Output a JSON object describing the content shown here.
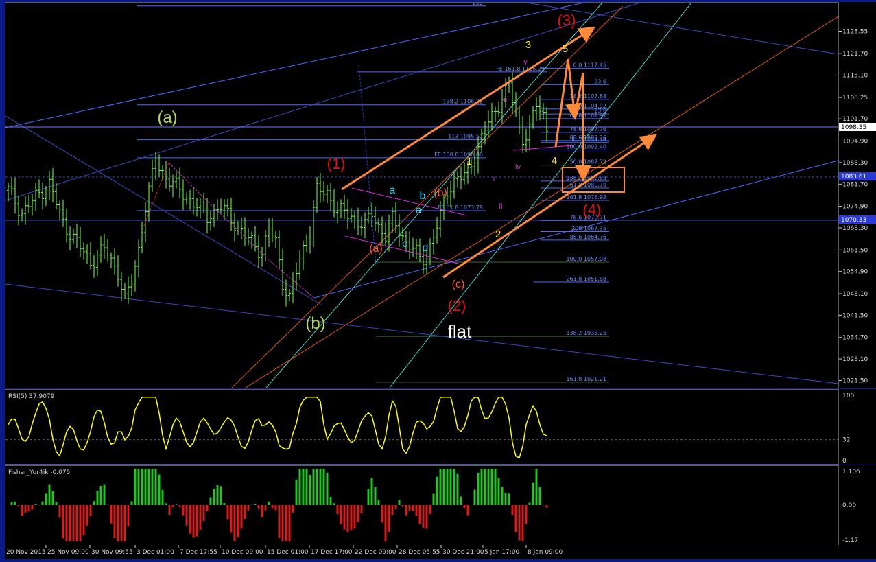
{
  "chart_data": [
    {
      "type": "candlestick",
      "panel": "price",
      "y_axis_ticks": [
        1128.55,
        1121.7,
        1115.1,
        1108.25,
        1101.7,
        1094.9,
        1088.3,
        1081.7,
        1074.9,
        1068.3,
        1061.5,
        1054.9,
        1048.1,
        1041.5,
        1034.7,
        1028.1,
        1021.5
      ],
      "ylim": [
        1019.5,
        1137.5
      ],
      "current_price_labels": [
        "1098.35",
        "1083.61",
        "1070.33"
      ],
      "x_tick_labels": [
        "20 Nov 2015",
        "25 Nov 09:00",
        "30 Nov 09:55",
        "3 Dec 01:00",
        "7 Dec 17:55",
        "10 Dec 09:00",
        "15 Dec 01:00",
        "17 Dec 17:00",
        "22 Dec 09:00",
        "28 Dec 05:55",
        "30 Dec 21:00",
        "5 Jan 17:00",
        "8 Jan 09:00"
      ],
      "close_path": [
        [
          0,
          1080
        ],
        [
          4,
          1073
        ],
        [
          8,
          1078
        ],
        [
          12,
          1082
        ],
        [
          16,
          1070
        ],
        [
          20,
          1064
        ],
        [
          24,
          1058
        ],
        [
          28,
          1062
        ],
        [
          32,
          1055
        ],
        [
          34,
          1046
        ],
        [
          36,
          1052
        ],
        [
          38,
          1062
        ],
        [
          40,
          1075
        ],
        [
          43,
          1089
        ],
        [
          46,
          1084
        ],
        [
          50,
          1080
        ],
        [
          54,
          1076
        ],
        [
          58,
          1072
        ],
        [
          62,
          1075
        ],
        [
          66,
          1070
        ],
        [
          70,
          1065
        ],
        [
          74,
          1061
        ],
        [
          76,
          1068
        ],
        [
          78,
          1064
        ],
        [
          80,
          1052
        ],
        [
          82,
          1047
        ],
        [
          84,
          1055
        ],
        [
          86,
          1062
        ],
        [
          88,
          1068
        ],
        [
          90,
          1080
        ],
        [
          93,
          1079
        ],
        [
          96,
          1074
        ],
        [
          100,
          1072
        ],
        [
          104,
          1069
        ],
        [
          106,
          1073
        ],
        [
          108,
          1069
        ],
        [
          110,
          1066
        ],
        [
          112,
          1071
        ],
        [
          114,
          1068
        ],
        [
          116,
          1064
        ],
        [
          118,
          1062
        ],
        [
          120,
          1059
        ],
        [
          122,
          1060
        ],
        [
          124,
          1066
        ],
        [
          126,
          1072
        ],
        [
          128,
          1080
        ],
        [
          130,
          1083
        ],
        [
          134,
          1085
        ],
        [
          136,
          1091
        ],
        [
          138,
          1096
        ],
        [
          140,
          1101
        ],
        [
          142,
          1104
        ],
        [
          144,
          1109
        ],
        [
          146,
          1112
        ],
        [
          148,
          1103
        ],
        [
          150,
          1096
        ],
        [
          152,
          1099
        ],
        [
          154,
          1106
        ],
        [
          156,
          1103
        ],
        [
          157,
          1099
        ]
      ],
      "fib_levels": [
        {
          "label": "200",
          "price": 1136.5
        },
        {
          "label": "FE 161.8 1116.29",
          "price": 1116.29
        },
        {
          "label": "0.0 1117.45",
          "price": 1117.45
        },
        {
          "label": "23.6",
          "price": 1112.4
        },
        {
          "label": "138.2 1106.22",
          "price": 1106.22
        },
        {
          "label": "38.2 1107.88",
          "price": 1107.88
        },
        {
          "label": "50.0 1104.92",
          "price": 1104.92
        },
        {
          "label": "61.8 1101.97",
          "price": 1101.97
        },
        {
          "label": "23.6",
          "price": 1103.4
        },
        {
          "label": "78.6 1097.76",
          "price": 1097.76
        },
        {
          "label": "113 1095.52",
          "price": 1095.52
        },
        {
          "label": "88.6 1095.26",
          "price": 1095.26
        },
        {
          "label": "38.2 1094.74",
          "price": 1094.74
        },
        {
          "label": "100.0 1092.40",
          "price": 1092.4
        },
        {
          "label": "FE 100.0 1090.00",
          "price": 1090.0
        },
        {
          "label": "50.0 1087.72",
          "price": 1087.72
        },
        {
          "label": "138.2 1082.83",
          "price": 1082.83
        },
        {
          "label": "61.8 1080.70",
          "price": 1080.7
        },
        {
          "label": "FE 61.8 1073.78",
          "price": 1073.78
        },
        {
          "label": "161.8 1076.92",
          "price": 1076.92
        },
        {
          "label": "78.6 1070.71",
          "price": 1070.71
        },
        {
          "label": "200 1067.35",
          "price": 1067.35
        },
        {
          "label": "88.6 1064.76",
          "price": 1064.76
        },
        {
          "label": "100.0 1057.98",
          "price": 1057.98
        },
        {
          "label": "261.8 1051.88",
          "price": 1051.88
        },
        {
          "label": "138.2 1035.25",
          "price": 1035.25
        },
        {
          "label": "161.8 1021.21",
          "price": 1021.21
        }
      ],
      "wave_labels": [
        {
          "text": "(a)",
          "color": "#b5d84a"
        },
        {
          "text": "(b)",
          "color": "#b5d84a"
        },
        {
          "text": "(1)",
          "color": "#e01010"
        },
        {
          "text": "(2)",
          "color": "#e01010"
        },
        {
          "text": "(3)",
          "color": "#e01010"
        },
        {
          "text": "(4)",
          "color": "#e01010"
        },
        {
          "text": "flat",
          "color": "#ffffff"
        },
        {
          "text": "(a)",
          "color": "#ff5a2a"
        },
        {
          "text": "(b)",
          "color": "#ff5a2a"
        },
        {
          "text": "(c)",
          "color": "#ff5a2a"
        },
        {
          "text": "a",
          "color": "#2ad8ff"
        },
        {
          "text": "b",
          "color": "#2ad8ff"
        },
        {
          "text": "c",
          "color": "#2ad8ff"
        },
        {
          "text": "d",
          "color": "#2ad8ff"
        },
        {
          "text": "e",
          "color": "#2ad8ff"
        },
        {
          "text": "1",
          "color": "#ffe81a"
        },
        {
          "text": "2",
          "color": "#ffe81a"
        },
        {
          "text": "3",
          "color": "#ffe81a"
        },
        {
          "text": "4",
          "color": "#ffe81a"
        },
        {
          "text": "5",
          "color": "#ffe81a"
        },
        {
          "text": "i",
          "color": "#cc33cc"
        },
        {
          "text": "ii",
          "color": "#cc33cc"
        },
        {
          "text": "iii",
          "color": "#cc33cc"
        },
        {
          "text": "iv",
          "color": "#cc33cc"
        },
        {
          "text": "v",
          "color": "#cc33cc"
        }
      ]
    },
    {
      "type": "line",
      "panel": "RSI",
      "title": "RSI(5) 37.9079",
      "ylim": [
        0,
        100
      ],
      "y_ticks": [
        "100",
        "32",
        "0"
      ],
      "series_color": "#ffff00"
    },
    {
      "type": "bar",
      "panel": "Fisher",
      "title": "Fisher_Yur4ik -0.075",
      "y_ticks": [
        "1.106",
        "0.00",
        "-1.17"
      ],
      "positive_color": "#1ec81e",
      "negative_color": "#e01818"
    }
  ],
  "colors": {
    "background": "#000000",
    "frame": "#0a1a8a",
    "candle": "#7cff4a",
    "orange": "#ff8a3a",
    "fib_blue": "#4a6aff",
    "channel_cyan": "#4ad8c8"
  }
}
